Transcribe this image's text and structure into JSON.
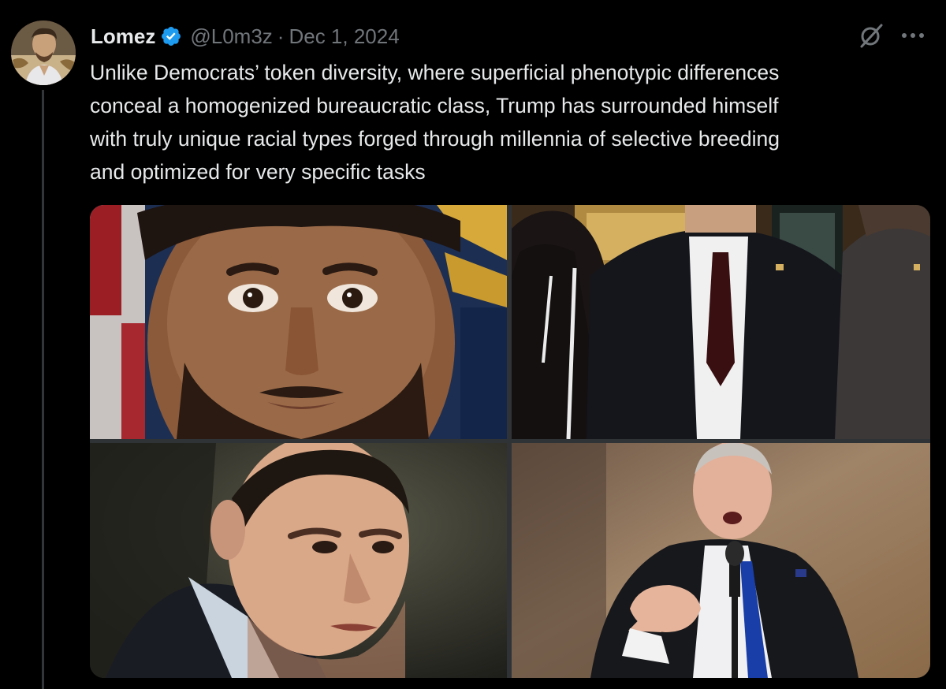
{
  "author": {
    "display_name": "Lomez",
    "handle": "@L0m3z",
    "separator": "·",
    "date": "Dec 1, 2024",
    "verified": true
  },
  "tweet": {
    "lines": [
      "Unlike Democrats’ token diversity, where superficial phenotypic differences",
      "conceal a homogenized bureaucratic class, Trump has surrounded himself",
      "with truly unique racial types forged through millennia of selective breeding",
      "and optimized for very specific tasks"
    ]
  },
  "icons": {
    "avatar": "profile-photo",
    "verified": "verified-badge-icon",
    "grok": "grok-icon",
    "more": "more-options-icon"
  },
  "media": {
    "photo_count": 4,
    "photos": [
      "photo-1",
      "photo-2",
      "photo-3",
      "photo-4"
    ]
  },
  "colors": {
    "background": "#000000",
    "text": "#e7e9ea",
    "muted": "#71767b",
    "verified_blue": "#1d9bf0",
    "thread_line": "#333639"
  }
}
